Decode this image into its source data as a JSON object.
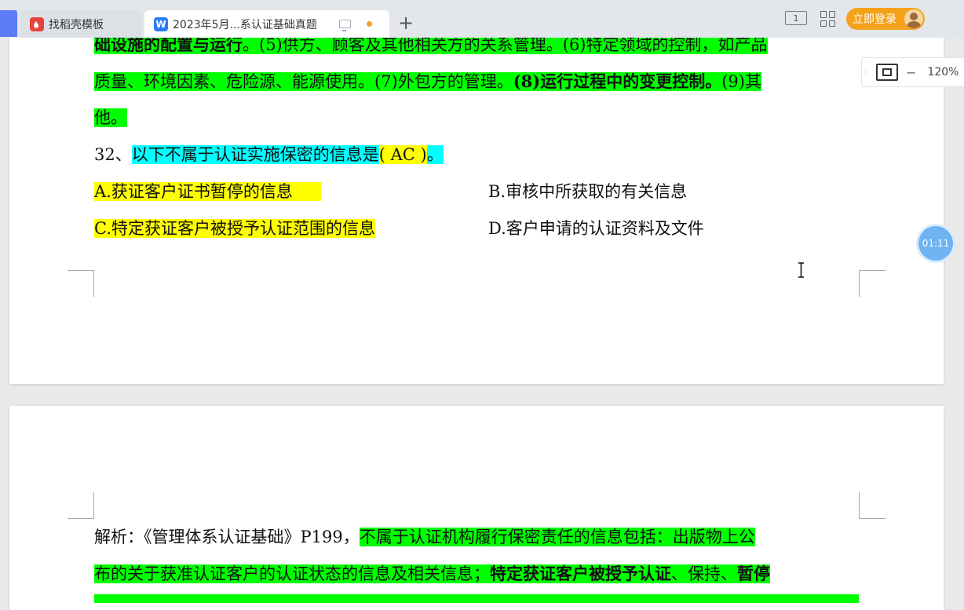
{
  "tabs": [
    {
      "label": "找稻壳模板"
    },
    {
      "label": "2023年5月...系认证基础真题"
    }
  ],
  "header": {
    "reader_icon_text": "1",
    "login_label": "立即登录"
  },
  "zoom": {
    "level": "120%"
  },
  "timer": {
    "text": "01:11"
  },
  "doc": {
    "line1": {
      "a": "础设施的配置与运行",
      "b": "。(5)供方、顾客及其他相关方的关系管理。(6)特定领域的控制，如产品"
    },
    "line2": {
      "a": "质量、环境因素、危险源、能源使用。(7)外包方的管理。",
      "b": "(8)运行过程中的变更控制。",
      "c": "(9)其"
    },
    "line3": "他。",
    "question": {
      "num": "32、",
      "text": "以下不属于认证实施保密的信息是",
      "answer": "( AC )",
      "end": "。"
    },
    "options": {
      "a": "A.获证客户证书暂停的信息",
      "b": "B.审核中所获取的有关信息",
      "c": "C.特定获证客户被授予认证范围的信息",
      "d": "D.客户申请的认证资料及文件"
    },
    "analysis": {
      "prefix": "解析：《管理体系认证基础》P199，",
      "hl1": "不属于认证机构履行保密责任的信息包括：出版物上公",
      "line2a": "布的关于获准认证客户的认证状态的信息及相关信息；",
      "line2b": "特定获证客户被授予认证",
      "line2c": "、保持、",
      "line2d": "暂停"
    }
  },
  "colors": {
    "green_highlight": "#00ff00",
    "yellow_highlight": "#ffff00",
    "cyan_highlight": "#00ffff",
    "login_orange": "#f5a21b",
    "wps_blue": "#2b7cf6"
  }
}
